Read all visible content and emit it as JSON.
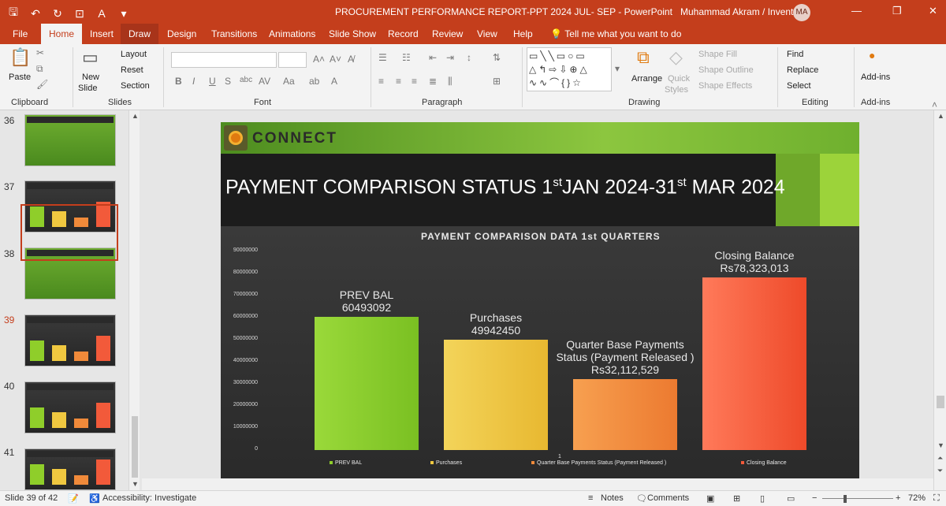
{
  "app": {
    "doc_title": "PROCUREMENT PERFORMANCE REPORT-PPT 2024 JUL- SEP",
    "app_name": "PowerPoint",
    "title_sep": "-",
    "user": "Muhammad Akram / Inventory",
    "avatar_initials": "MA"
  },
  "tabs": [
    "File",
    "Home",
    "Insert",
    "Draw",
    "Design",
    "Transitions",
    "Animations",
    "Slide Show",
    "Record",
    "Review",
    "View",
    "Help"
  ],
  "tell_me": "Tell me what you want to do",
  "ribbon": {
    "clipboard": {
      "paste": "Paste",
      "label": "Clipboard"
    },
    "slides": {
      "new_slide": "New",
      "new_slide2": "Slide",
      "layout": "Layout",
      "reset": "Reset",
      "section": "Section",
      "label": "Slides"
    },
    "font": {
      "label": "Font"
    },
    "paragraph": {
      "label": "Paragraph"
    },
    "drawing": {
      "arrange": "Arrange",
      "quick_styles": "Quick",
      "quick_styles2": "Styles",
      "shape_fill": "Shape Fill",
      "shape_outline": "Shape Outline",
      "shape_effects": "Shape Effects",
      "label": "Drawing"
    },
    "editing": {
      "find": "Find",
      "replace": "Replace",
      "select": "Select",
      "label": "Editing"
    },
    "addins": {
      "addins": "Add-ins",
      "label": "Add-ins"
    }
  },
  "thumbnails": [
    {
      "num": "36",
      "theme": "green"
    },
    {
      "num": "37",
      "theme": "dark"
    },
    {
      "num": "38",
      "theme": "green"
    },
    {
      "num": "39",
      "theme": "dark",
      "selected": true
    },
    {
      "num": "40",
      "theme": "dark"
    },
    {
      "num": "41",
      "theme": "dark"
    }
  ],
  "slide": {
    "logo_text": "CONNECT",
    "title_part1": "PAYMENT COMPARISON STATUS 1",
    "title_sup1": "st",
    "title_part2": "JAN 2024-31",
    "title_sup2": "st",
    "title_part3": " MAR 2024"
  },
  "chart_data": {
    "type": "bar",
    "title": "PAYMENT COMPARISON DATA 1st QUARTERS",
    "categories": [
      "PREV BAL",
      "Purchases",
      "Quarter Base Payments Status (Payment Released )",
      "Closing  Balance"
    ],
    "values": [
      60493092,
      49942450,
      32112529,
      78323013
    ],
    "data_labels": [
      [
        "PREV BAL",
        "60493092"
      ],
      [
        "Purchases",
        "49942450"
      ],
      [
        "Quarter Base Payments",
        "Status (Payment Released )",
        "Rs32,112,529"
      ],
      [
        "Closing  Balance",
        "Rs78,323,013"
      ]
    ],
    "yticks": [
      "90000000",
      "80000000",
      "70000000",
      "60000000",
      "50000000",
      "40000000",
      "30000000",
      "20000000",
      "10000000",
      "0"
    ],
    "ylim": [
      0,
      90000000
    ],
    "legend_axis_number": "1",
    "colors": [
      "#8fce2a",
      "#f0c840",
      "#f08a3a",
      "#f25a3a"
    ],
    "legend": "bottom"
  },
  "status": {
    "slide_of": "Slide 39 of 42",
    "accessibility": "Accessibility: Investigate",
    "notes": "Notes",
    "comments": "Comments",
    "zoom": "72%"
  }
}
